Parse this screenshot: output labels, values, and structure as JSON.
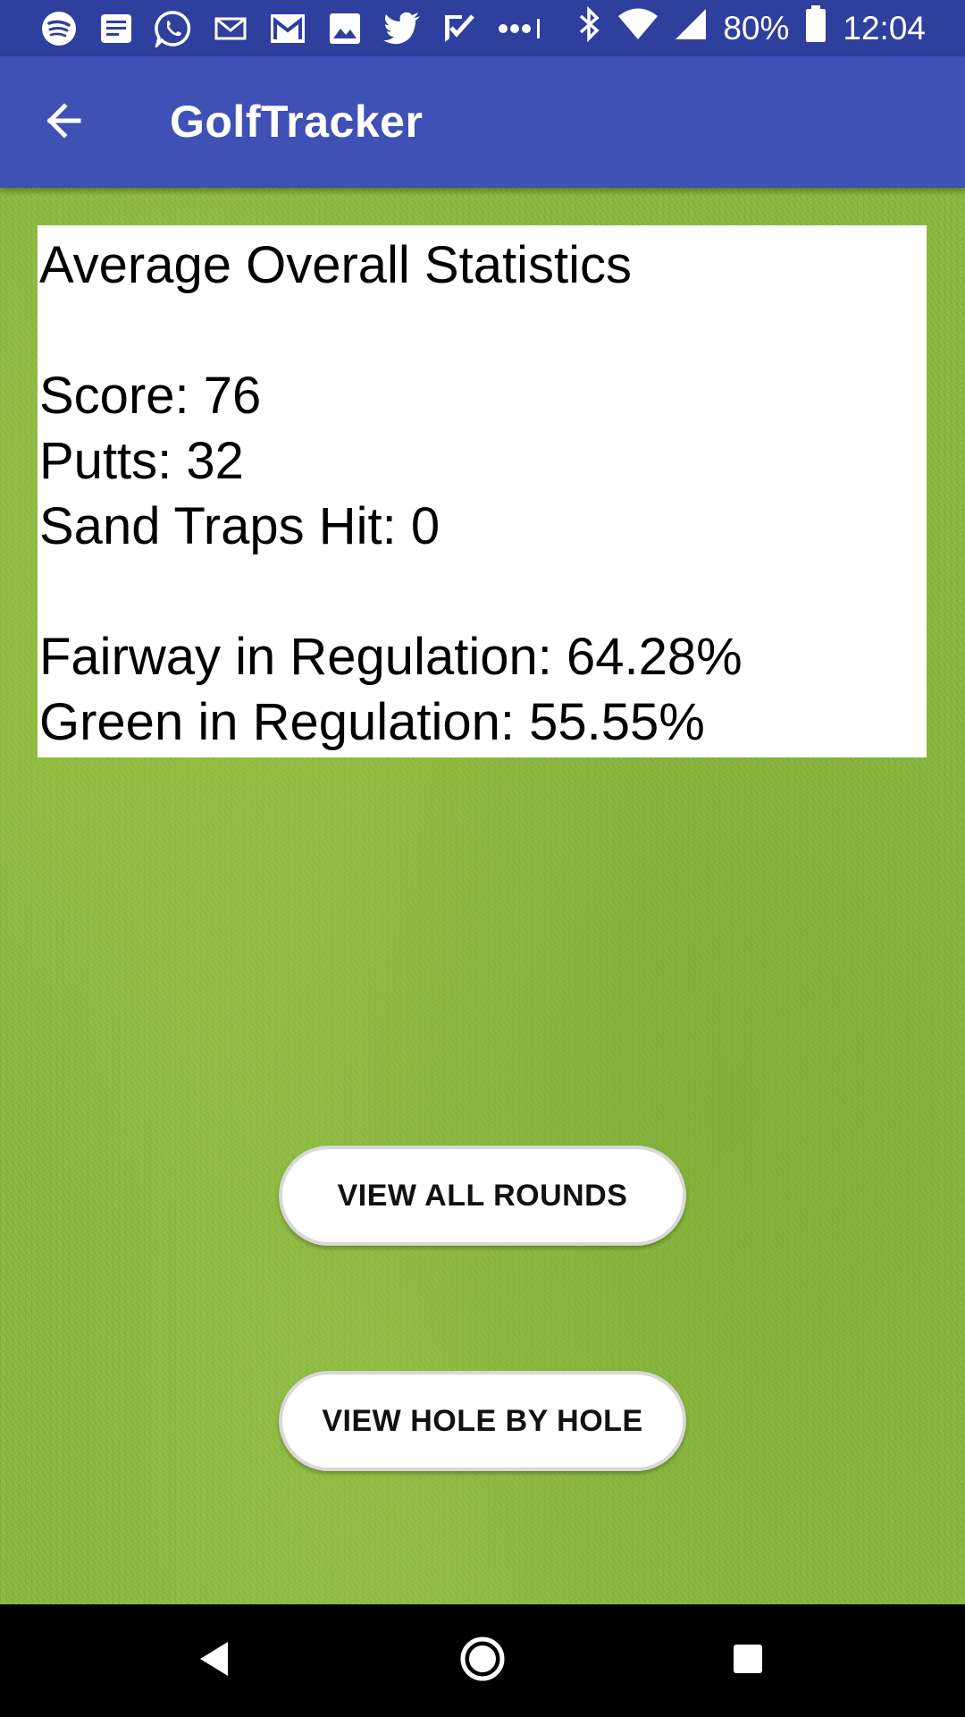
{
  "status_bar": {
    "notification_icons": [
      "spotify-icon",
      "news-icon",
      "whatsapp-icon",
      "mail-icon",
      "gmail-icon",
      "photos-icon",
      "twitter-icon",
      "check-app-icon",
      "more-notifications-icon"
    ],
    "status_icons": [
      "bluetooth-icon",
      "wifi-icon",
      "cell-signal-icon",
      "battery-icon"
    ],
    "battery": "80%",
    "time": "12:04"
  },
  "app_bar": {
    "title": "GolfTracker",
    "back_icon": "arrow-back-icon",
    "background_color": "#3f51b5"
  },
  "stats": {
    "heading": "Average Overall Statistics",
    "score": "Score: 76",
    "putts": "Putts: 32",
    "sand_traps": "Sand Traps Hit: 0",
    "fairway": "Fairway in Regulation: 64.28%",
    "green": "Green in Regulation: 55.55%"
  },
  "buttons": {
    "view_all_rounds": "VIEW ALL ROUNDS",
    "view_hole_by_hole": "VIEW HOLE BY HOLE"
  },
  "nav_bar": {
    "icons": [
      "back-triangle-icon",
      "home-circle-icon",
      "recents-square-icon"
    ]
  }
}
